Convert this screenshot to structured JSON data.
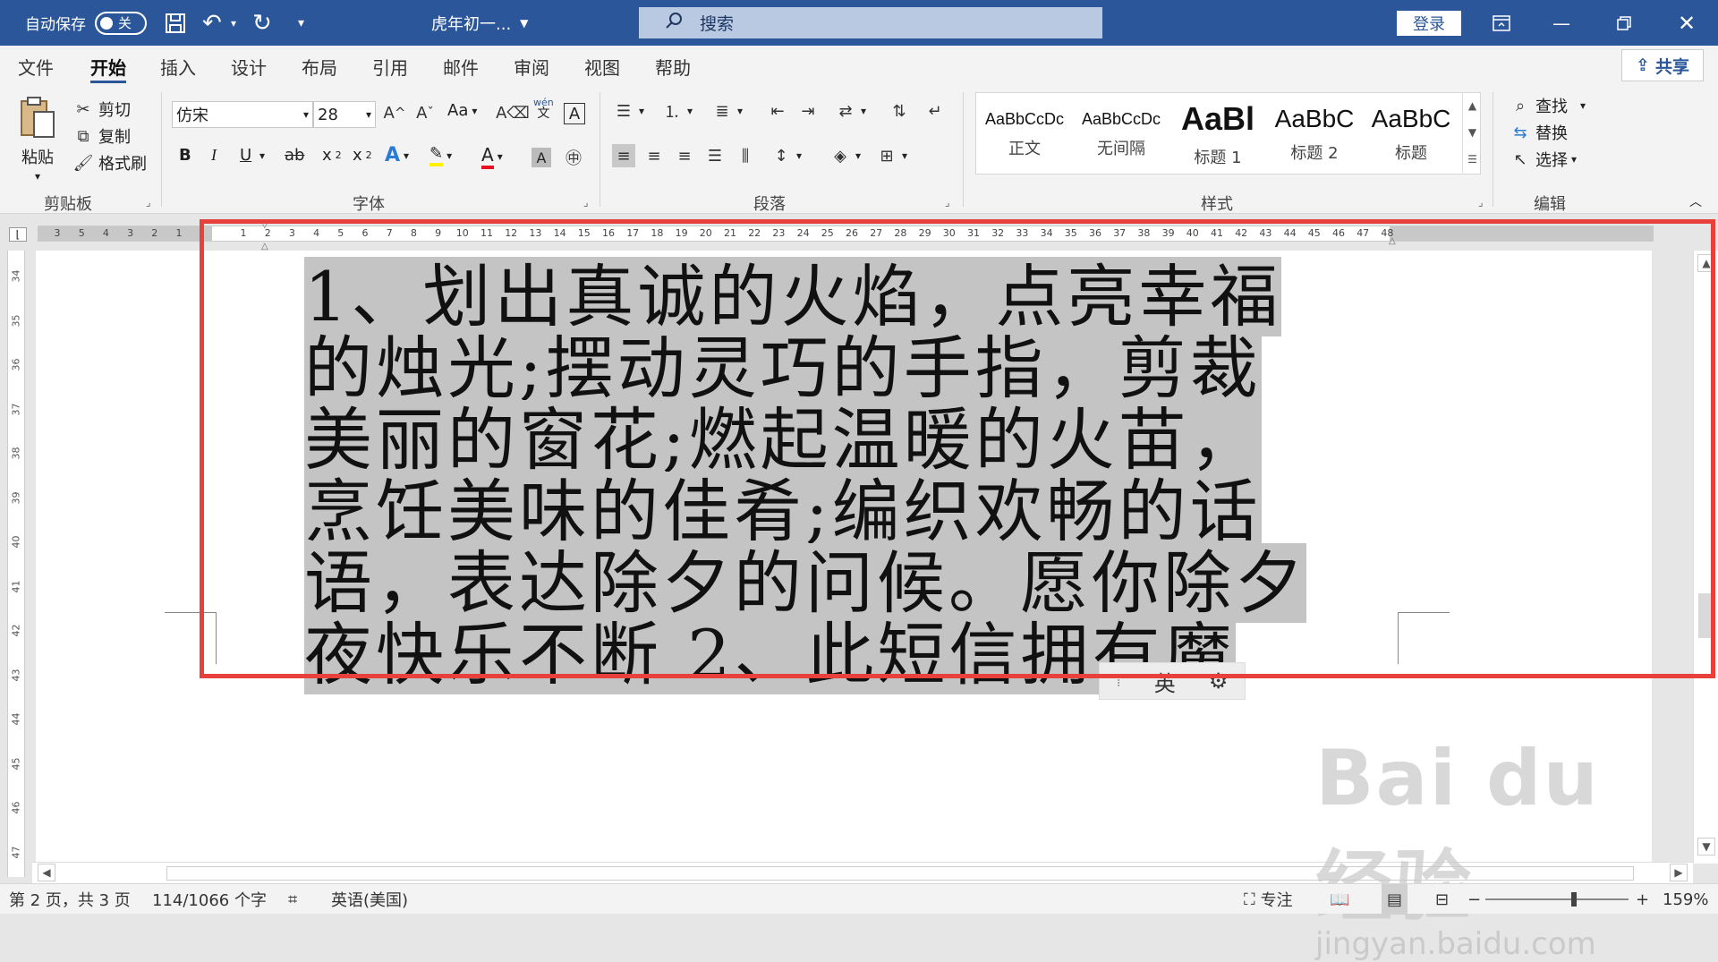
{
  "titlebar": {
    "autosave_label": "自动保存",
    "autosave_state": "关",
    "doc_title": "虎年初一...",
    "search_placeholder": "搜索",
    "login_label": "登录"
  },
  "menu": {
    "tabs": [
      "文件",
      "开始",
      "插入",
      "设计",
      "布局",
      "引用",
      "邮件",
      "审阅",
      "视图",
      "帮助"
    ],
    "active_tab": "开始",
    "share_label": "共享"
  },
  "ribbon": {
    "clipboard": {
      "label": "剪贴板",
      "paste": "粘贴",
      "cut": "剪切",
      "copy": "复制",
      "format_painter": "格式刷"
    },
    "font": {
      "label": "字体",
      "font_name": "仿宋",
      "font_size": "28",
      "aa_label": "Aa",
      "wen_label": "wén",
      "wen_sub": "文",
      "box_a": "A",
      "bold": "B",
      "italic": "I",
      "underline": "U",
      "strike": "ab",
      "subscript": "x",
      "superscript": "x",
      "font_color_glyph": "A"
    },
    "paragraph": {
      "label": "段落"
    },
    "styles": {
      "label": "样式",
      "items": [
        {
          "sample": "AaBbCcDc",
          "name": "正文",
          "size": 18
        },
        {
          "sample": "AaBbCcDc",
          "name": "无间隔",
          "size": 18
        },
        {
          "sample": "AaBl",
          "name": "标题 1",
          "size": 36
        },
        {
          "sample": "AaBbC",
          "name": "标题 2",
          "size": 28
        },
        {
          "sample": "AaBbC",
          "name": "标题",
          "size": 28
        }
      ]
    },
    "editing": {
      "label": "编辑",
      "find": "查找",
      "replace": "替换",
      "select": "选择"
    }
  },
  "ruler": {
    "left_numbers": [
      "3",
      "5",
      "4",
      "3",
      "2",
      "1"
    ],
    "right_numbers": [
      "1",
      "2",
      "3",
      "4",
      "5",
      "6",
      "7",
      "8",
      "9",
      "10",
      "11",
      "12",
      "13",
      "14",
      "15",
      "16",
      "17",
      "18",
      "19",
      "20",
      "21",
      "22",
      "23",
      "24",
      "25",
      "26",
      "27",
      "28",
      "29",
      "30",
      "31",
      "32",
      "33",
      "34",
      "35",
      "36",
      "37",
      "38",
      "39",
      "40",
      "41",
      "42",
      "43",
      "44",
      "45",
      "46",
      "47",
      "48"
    ],
    "vertical_numbers": [
      "34",
      "35",
      "36",
      "37",
      "38",
      "39",
      "40",
      "41",
      "42",
      "43",
      "44",
      "45",
      "46",
      "47"
    ]
  },
  "document": {
    "lines": [
      "1、划出真诚的火焰，点亮幸福",
      "的烛光;摆动灵巧的手指，剪裁",
      "美丽的窗花;燃起温暖的火苗，",
      "烹饪美味的佳肴;编织欢畅的话",
      "语，表达除夕的问候。愿你除夕",
      "夜快乐不断 2、此短信拥有魔"
    ],
    "ime_mode": "英"
  },
  "statusbar": {
    "page_info": "第 2 页，共 3 页",
    "word_count": "114/1066 个字",
    "language": "英语(美国)",
    "focus": "专注",
    "zoom_minus": "−",
    "zoom_plus": "+",
    "zoom": "159%",
    "zoom_fraction": 0.6
  },
  "watermark": {
    "main": "Bai du 经验",
    "sub": "jingyan.baidu.com"
  },
  "colors": {
    "titlebar": "#2b579a",
    "selection": "#c4c4c4",
    "highlight_border": "#e8403a"
  }
}
